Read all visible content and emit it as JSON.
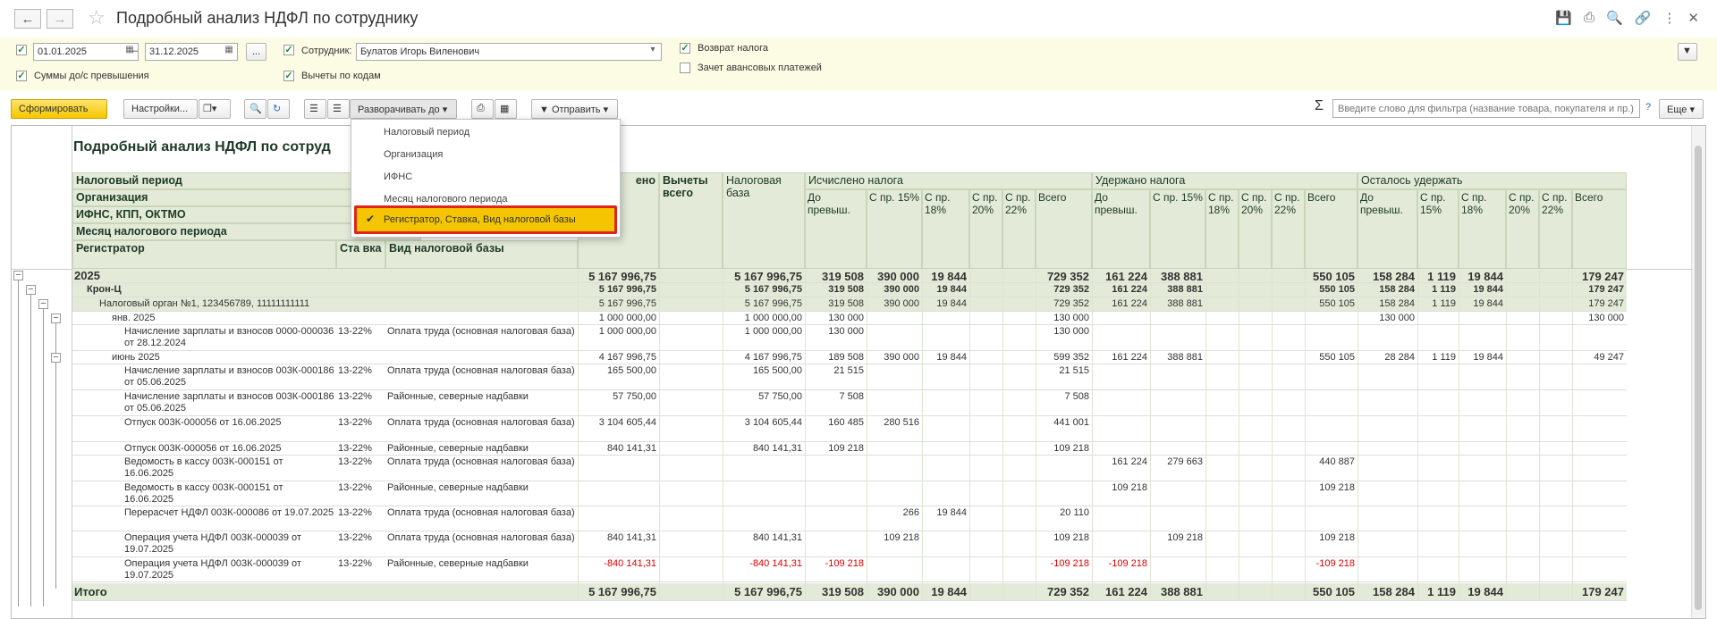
{
  "window": {
    "title": "Подробный анализ НДФЛ по сотруднику"
  },
  "filters": {
    "date_from": "01.01.2025",
    "date_to": "31.12.2025",
    "dash": "–",
    "more": "...",
    "employee_label": "Сотрудник:",
    "employee_value": "Булатов Игорь Виленович",
    "sums_label": "Суммы до/с превышения",
    "deductions_label": "Вычеты по кодам",
    "refund_label": "Возврат налога",
    "offset_label": "Зачет авансовых платежей"
  },
  "toolbar": {
    "generate": "Сформировать",
    "settings": "Настройки...",
    "expand": "Разворачивать до",
    "send": "Отправить",
    "search_placeholder": "Введите слово для фильтра (название товара, покупателя и пр.)",
    "help": "?",
    "more": "Еще",
    "sigma": "Σ"
  },
  "dropdown": {
    "items": [
      "Налоговый период",
      "Организация",
      "ИФНС",
      "Месяц налогового периода",
      "Регистратор, Ставка, Вид налоговой базы"
    ]
  },
  "report": {
    "title": "Подробный анализ НДФЛ по сотруд",
    "groups": [
      "Налоговый период",
      "Организация",
      "ИФНС, КПП, ОКТМО",
      "Месяц налогового периода"
    ],
    "col_registrar": "Регистратор",
    "col_rate": "Ста вка",
    "col_base_type": "Вид налоговой базы",
    "col_income_tail": "ено",
    "col_deduct": "Вычеты всего",
    "col_taxbase": "Налоговая база",
    "grp_calc": "Исчислено налога",
    "grp_withheld": "Удержано налога",
    "grp_remain": "Осталось удержать",
    "sub": [
      "До превыш.",
      "С пр. 15%",
      "С пр. 18%",
      "С пр. 20%",
      "С пр. 22%",
      "Всего"
    ],
    "rows": [
      {
        "label": "2025",
        "style": "year",
        "v": [
          "5 167 996,75",
          "",
          "5 167 996,75",
          "319 508",
          "390 000",
          "19 844",
          "",
          "",
          "729 352",
          "161 224",
          "388 881",
          "",
          "",
          "",
          "550 105",
          "158 284",
          "1 119",
          "19 844",
          "",
          "",
          "179 247"
        ]
      },
      {
        "label": "Крон-Ц",
        "style": "org",
        "v": [
          "5 167 996,75",
          "",
          "5 167 996,75",
          "319 508",
          "390 000",
          "19 844",
          "",
          "",
          "729 352",
          "161 224",
          "388 881",
          "",
          "",
          "",
          "550 105",
          "158 284",
          "1 119",
          "19 844",
          "",
          "",
          "179 247"
        ]
      },
      {
        "label": "Налоговый орган №1, 123456789, 11111111111",
        "style": "ifns",
        "v": [
          "5 167 996,75",
          "",
          "5 167 996,75",
          "319 508",
          "390 000",
          "19 844",
          "",
          "",
          "729 352",
          "161 224",
          "388 881",
          "",
          "",
          "",
          "550 105",
          "158 284",
          "1 119",
          "19 844",
          "",
          "",
          "179 247"
        ]
      },
      {
        "label": "янв. 2025",
        "style": "month",
        "v": [
          "1 000 000,00",
          "",
          "1 000 000,00",
          "130 000",
          "",
          "",
          "",
          "",
          "130 000",
          "",
          "",
          "",
          "",
          "",
          "",
          "130 000",
          "",
          "",
          "",
          "",
          "130 000"
        ]
      },
      {
        "label": "Начисление зарплаты и взносов 0000-000036 от 28.12.2024",
        "rate": "13-22%",
        "base": "Оплата труда (основная налоговая база)",
        "style": "doc",
        "v": [
          "1 000 000,00",
          "",
          "1 000 000,00",
          "130 000",
          "",
          "",
          "",
          "",
          "130 000",
          "",
          "",
          "",
          "",
          "",
          "",
          "",
          "",
          "",
          "",
          "",
          ""
        ]
      },
      {
        "label": "июнь 2025",
        "style": "month",
        "v": [
          "4 167 996,75",
          "",
          "4 167 996,75",
          "189 508",
          "390 000",
          "19 844",
          "",
          "",
          "599 352",
          "161 224",
          "388 881",
          "",
          "",
          "",
          "550 105",
          "28 284",
          "1 119",
          "19 844",
          "",
          "",
          "49 247"
        ]
      },
      {
        "label": "Начисление зарплаты и взносов 003К-000186 от 05.06.2025",
        "rate": "13-22%",
        "base": "Оплата труда (основная налоговая база)",
        "style": "doc",
        "v": [
          "165 500,00",
          "",
          "165 500,00",
          "21 515",
          "",
          "",
          "",
          "",
          "21 515",
          "",
          "",
          "",
          "",
          "",
          "",
          "",
          "",
          "",
          "",
          "",
          ""
        ]
      },
      {
        "label": "Начисление зарплаты и взносов 003К-000186 от 05.06.2025",
        "rate": "13-22%",
        "base": "Районные, северные надбавки",
        "style": "doc",
        "v": [
          "57 750,00",
          "",
          "57 750,00",
          "7 508",
          "",
          "",
          "",
          "",
          "7 508",
          "",
          "",
          "",
          "",
          "",
          "",
          "",
          "",
          "",
          "",
          "",
          ""
        ]
      },
      {
        "label": "Отпуск 003К-000056 от 16.06.2025",
        "rate": "13-22%",
        "base": "Оплата труда (основная налоговая база)",
        "style": "doc",
        "v": [
          "3 104 605,44",
          "",
          "3 104 605,44",
          "160 485",
          "280 516",
          "",
          "",
          "",
          "441 001",
          "",
          "",
          "",
          "",
          "",
          "",
          "",
          "",
          "",
          "",
          "",
          ""
        ]
      },
      {
        "label": "Отпуск 003К-000056 от 16.06.2025",
        "rate": "13-22%",
        "base": "Районные, северные надбавки",
        "style": "doc",
        "v": [
          "840 141,31",
          "",
          "840 141,31",
          "109 218",
          "",
          "",
          "",
          "",
          "109 218",
          "",
          "",
          "",
          "",
          "",
          "",
          "",
          "",
          "",
          "",
          "",
          ""
        ]
      },
      {
        "label": "Ведомость в кассу 003К-000151 от 16.06.2025",
        "rate": "13-22%",
        "base": "Оплата труда (основная налоговая база)",
        "style": "doc",
        "v": [
          "",
          "",
          "",
          "",
          "",
          "",
          "",
          "",
          "",
          "161 224",
          "279 663",
          "",
          "",
          "",
          "440 887",
          "",
          "",
          "",
          "",
          "",
          ""
        ]
      },
      {
        "label": "Ведомость в кассу 003К-000151 от 16.06.2025",
        "rate": "13-22%",
        "base": "Районные, северные надбавки",
        "style": "doc",
        "v": [
          "",
          "",
          "",
          "",
          "",
          "",
          "",
          "",
          "",
          "109 218",
          "",
          "",
          "",
          "",
          "109 218",
          "",
          "",
          "",
          "",
          "",
          ""
        ]
      },
      {
        "label": "Перерасчет НДФЛ 003К-000086 от 19.07.2025",
        "rate": "13-22%",
        "base": "Оплата труда (основная налоговая база)",
        "style": "doc",
        "v": [
          "",
          "",
          "",
          "",
          "266",
          "19 844",
          "",
          "",
          "20 110",
          "",
          "",
          "",
          "",
          "",
          "",
          "",
          "",
          "",
          "",
          "",
          ""
        ]
      },
      {
        "label": "Операция учета НДФЛ 003К-000039 от 19.07.2025",
        "rate": "13-22%",
        "base": "Оплата труда (основная налоговая база)",
        "style": "doc",
        "v": [
          "840 141,31",
          "",
          "840 141,31",
          "",
          "109 218",
          "",
          "",
          "",
          "109 218",
          "",
          "109 218",
          "",
          "",
          "",
          "109 218",
          "",
          "",
          "",
          "",
          "",
          ""
        ]
      },
      {
        "label": "Операция учета НДФЛ 003К-000039 от 19.07.2025",
        "rate": "13-22%",
        "base": "Районные, северные надбавки",
        "style": "doc",
        "neg": true,
        "v": [
          "-840 141,31",
          "",
          "-840 141,31",
          "-109 218",
          "",
          "",
          "",
          "",
          "-109 218",
          "-109 218",
          "",
          "",
          "",
          "",
          "-109 218",
          "",
          "",
          "",
          "",
          "",
          ""
        ]
      }
    ],
    "total": {
      "label": "Итого",
      "v": [
        "5 167 996,75",
        "",
        "5 167 996,75",
        "319 508",
        "390 000",
        "19 844",
        "",
        "",
        "729 352",
        "161 224",
        "388 881",
        "",
        "",
        "",
        "550 105",
        "158 284",
        "1 119",
        "19 844",
        "",
        "",
        "179 247"
      ]
    }
  }
}
